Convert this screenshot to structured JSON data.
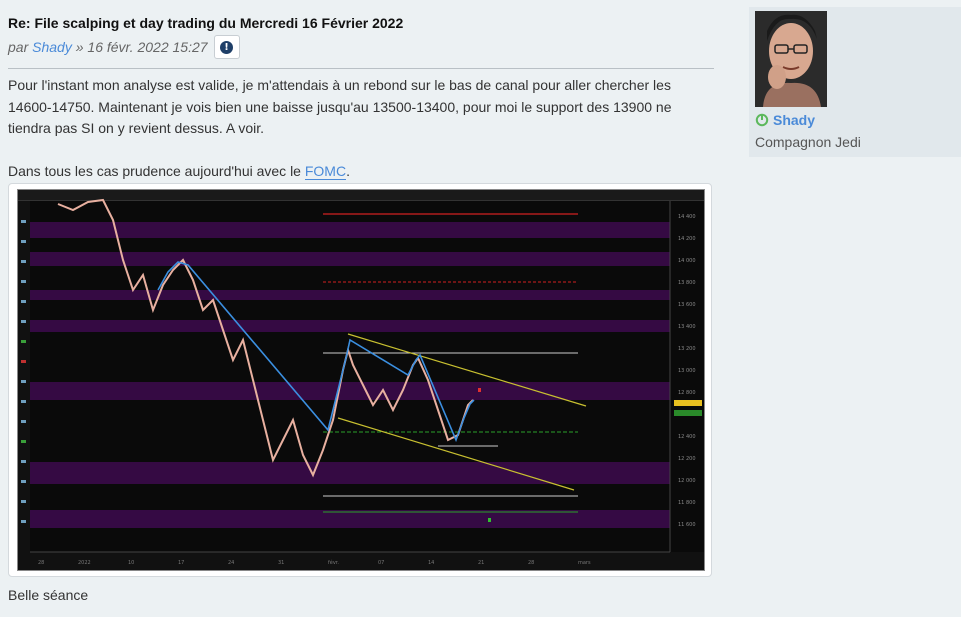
{
  "post": {
    "title": "Re: File scalping et day trading du Mercredi 16 Février 2022",
    "meta_by": "par",
    "author": "Shady",
    "meta_sep": "»",
    "date": "16 févr. 2022 15:27",
    "info_icon": "info-circle-icon",
    "paragraph1": "Pour l'instant mon analyse est valide, je m'attendais à un rebond sur le bas de canal pour aller chercher les 14600-14750. Maintenant je vois bien une baisse jusqu'au 13500-13400, pour moi le support des 13900 ne tiendra pas SI on y revient dessus. A voir.",
    "paragraph2_prefix": "Dans tous les cas prudence aujourd'hui avec le ",
    "paragraph2_link": "FOMC",
    "paragraph2_suffix": ".",
    "closing": "Belle séance"
  },
  "profile": {
    "username": "Shady",
    "rank": "Compagnon Jedi",
    "status_icon": "online-power-icon",
    "status_color": "#5cb85c"
  },
  "chart_image": {
    "background": "#0a0a0a",
    "up_color": "#3b8fe0",
    "down_color": "#e8b0a0",
    "channel_color": "#c8c030",
    "zone_color": "#3a0a4a",
    "price_labels": [
      "14 400",
      "14 200",
      "14 000",
      "13 800",
      "13 600",
      "13 400",
      "13 200",
      "13 000",
      "12 800",
      "12 600",
      "12 400",
      "12 200",
      "12 000",
      "11 800",
      "11 600"
    ]
  }
}
